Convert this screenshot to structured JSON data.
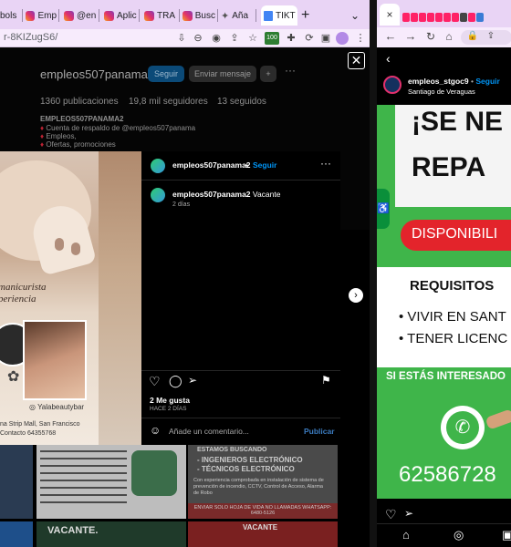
{
  "left_browser": {
    "tabs": [
      "bols",
      "Emp",
      "@en",
      "Aplic",
      "TRA",
      "Busc",
      "Aña",
      "TIKT"
    ],
    "new_tab": "+",
    "window_chevron": "⌄",
    "url": "r-8KIZugS6/",
    "extension_badge": "100"
  },
  "profile": {
    "username": "empleos507panama2",
    "follow_button": "Seguir",
    "message_button": "Enviar mensaje",
    "more": "···",
    "stats": [
      "1360 publicaciones",
      "19,8 mil seguidores",
      "13 seguidos"
    ],
    "bio_name": "EMPLEOS507PANAMA2",
    "bio_lines": [
      "Cuenta de respaldo de @empleos507panama",
      "Empleos,",
      "Ofertas, promociones"
    ]
  },
  "post": {
    "author": "empleos507panama2",
    "dot": "•",
    "follow": "Seguir",
    "caption_author": "empleos507panama2",
    "caption_text": "Vacante",
    "caption_time": "2 días",
    "likes": "2 Me gusta",
    "date": "HACE 2 DÍAS",
    "comment_placeholder": "Añade un comentario...",
    "publish": "Publicar",
    "image_text": {
      "headline1": "manicurista",
      "headline2": "periencia",
      "instagram": "Yalabeautybar",
      "address": "na Strip Mall, San Francisco",
      "contact": "Contacto 64355768"
    }
  },
  "grid": {
    "cell2_lines": [
      "ESTAMOS BUSCANDO",
      "- INGENIEROS ELECTRÓNICO",
      "- TÉCNICOS ELECTRÓNICO"
    ],
    "cell2_body": "Con experiencia comprobada en instalación de sistema de prevención de incendio, CCTV, Control de Acceso, Alarma de Robo",
    "cell2_footer": "ENVIAR SOLO HOJA DE VIDA NO LLAMADAS WHATSAPP: 6480-5126",
    "cell_bottom_mid": "VACANTE.",
    "cell_bottom_right": "VACANTE"
  },
  "right_browser": {
    "tab_x": "×",
    "story": {
      "username": "empleos_stgoc9",
      "follow": "Seguir",
      "location": "Santiago de Veraguas",
      "headline1": "¡SE NE",
      "headline2": "REPA",
      "disponible": "DISPONIBILI",
      "requisitos": "REQUISITOS",
      "req1": "VIVIR EN SANT",
      "req2": "TENER LICENC",
      "interesado": "SI ESTÁS INTERESADO",
      "phone": "62586728"
    }
  },
  "colors": {
    "tab_bar": "#e9d4f5",
    "ig_blue": "#0095f6",
    "story_green": "#3fb54a",
    "story_red": "#e3242b"
  }
}
